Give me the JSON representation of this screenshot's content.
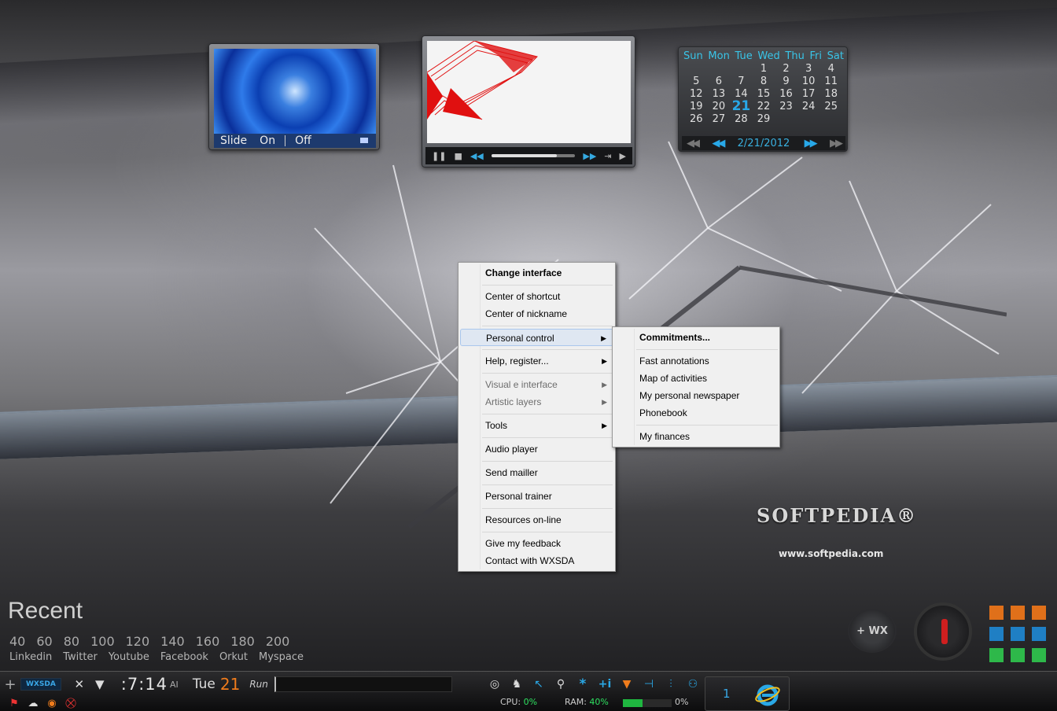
{
  "slideshow": {
    "slide_label": "Slide",
    "on_label": "On",
    "off_label": "Off"
  },
  "player": {
    "progress": 0.78
  },
  "calendar": {
    "weekdays": [
      "Sun",
      "Mon",
      "Tue",
      "Wed",
      "Thu",
      "Fri",
      "Sat"
    ],
    "weeks": [
      [
        "",
        "",
        "",
        "1",
        "2",
        "3",
        "4"
      ],
      [
        "5",
        "6",
        "7",
        "8",
        "9",
        "10",
        "11"
      ],
      [
        "12",
        "13",
        "14",
        "15",
        "16",
        "17",
        "18"
      ],
      [
        "19",
        "20",
        "21",
        "22",
        "23",
        "24",
        "25"
      ],
      [
        "26",
        "27",
        "28",
        "29",
        "",
        "",
        ""
      ]
    ],
    "today": "21",
    "date": "2/21/2012"
  },
  "context_menu": {
    "change_interface": "Change interface",
    "center_of_shortcut": "Center of shortcut",
    "center_of_nickname": "Center of nickname",
    "personal_control": "Personal control",
    "help_register": "Help, register...",
    "visual_interface": "Visual e interface",
    "artistic_layers": "Artistic layers",
    "tools": "Tools",
    "audio_player": "Audio player",
    "send_mailler": "Send mailler",
    "personal_trainer": "Personal trainer",
    "resources_online": "Resources on-line",
    "give_feedback": "Give my feedback",
    "contact": "Contact with WXSDA"
  },
  "submenu": {
    "commitments": "Commitments...",
    "fast_annotations": "Fast annotations",
    "map_of_activities": "Map of activities",
    "personal_newspaper": "My personal newspaper",
    "phonebook": "Phonebook",
    "my_finances": "My finances"
  },
  "wallpaper": {
    "logo": "SOFTPEDIA®",
    "url": "www.softpedia.com"
  },
  "recent": {
    "title": "Recent",
    "numbers": [
      "40",
      "60",
      "80",
      "100",
      "120",
      "140",
      "160",
      "180",
      "200"
    ],
    "links": [
      "Linkedin",
      "Twitter",
      "Youtube",
      "Facebook",
      "Orkut",
      "Myspace"
    ]
  },
  "wx_button": "+ WX",
  "tile_colors": [
    "#e0701a",
    "#e0701a",
    "#e0701a",
    "#1f7fc4",
    "#1f7fc4",
    "#1f7fc4",
    "#2eb84a",
    "#2eb84a",
    "#2eb84a"
  ],
  "taskbar": {
    "label": "WXSDA",
    "time": ":7:14",
    "ampm": "AI",
    "day": "Tue",
    "date": "21",
    "run_label": "Run",
    "cpu_label": "CPU:",
    "cpu_value": "0%",
    "ram_label": "RAM:",
    "ram_value": "40%",
    "ram_fraction": 0.4,
    "disk_value": "0%",
    "task_count": "1"
  },
  "colors": {
    "accent": "#2aa8e6",
    "orange": "#f07c1c",
    "green": "#2ee060",
    "red": "#cf1f1f"
  }
}
